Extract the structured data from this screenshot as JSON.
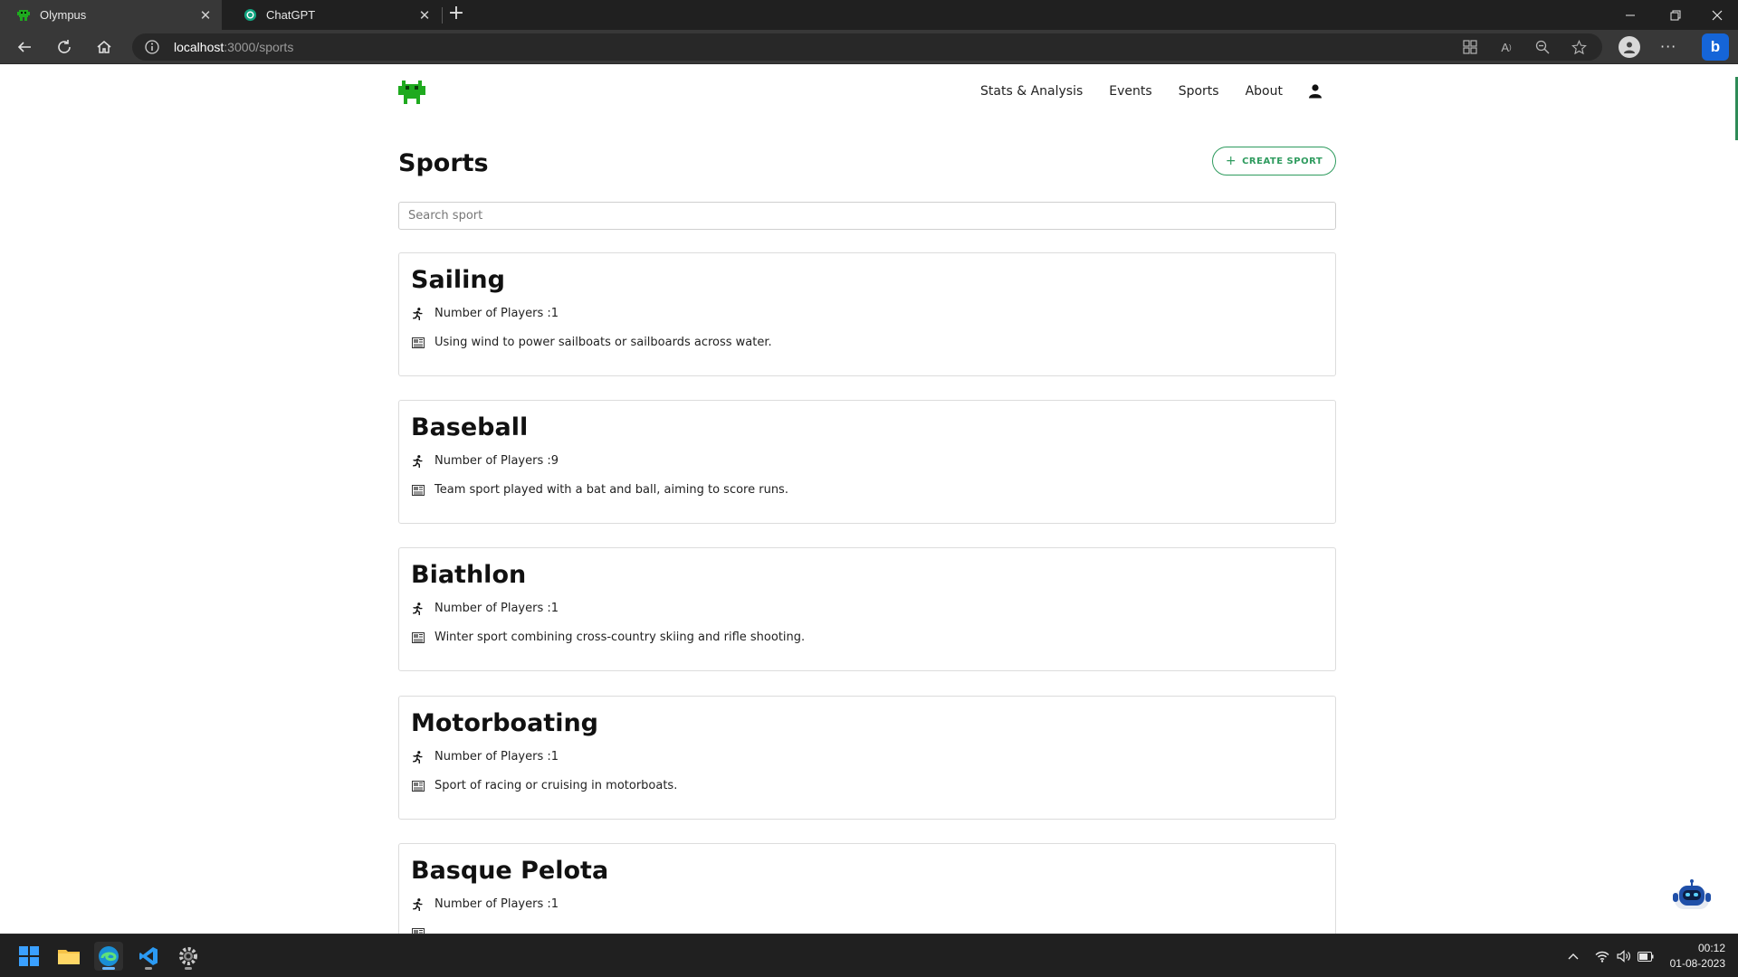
{
  "browser": {
    "tabs": [
      {
        "title": "Olympus",
        "active": true
      },
      {
        "title": "ChatGPT",
        "active": false
      }
    ],
    "url_host": "localhost",
    "url_path": ":3000/sports"
  },
  "site": {
    "nav": {
      "stats": "Stats & Analysis",
      "events": "Events",
      "sports": "Sports",
      "about": "About"
    },
    "page_title": "Sports",
    "create_button": "CREATE SPORT",
    "search_placeholder": "Search sport",
    "players_label": "Number of Players : ",
    "sports": [
      {
        "name": "Sailing",
        "players": "1",
        "description": "Using wind to power sailboats or sailboards across water."
      },
      {
        "name": "Baseball",
        "players": "9",
        "description": "Team sport played with a bat and ball, aiming to score runs."
      },
      {
        "name": "Biathlon",
        "players": "1",
        "description": "Winter sport combining cross-country skiing and rifle shooting."
      },
      {
        "name": "Motorboating",
        "players": "1",
        "description": "Sport of racing or cruising in motorboats."
      },
      {
        "name": "Basque Pelota",
        "players": "1",
        "description": ""
      }
    ]
  },
  "taskbar": {
    "time": "00:12",
    "date": "01-08-2023"
  },
  "colors": {
    "accent": "#2e9b5e",
    "logo": "#1faa1f",
    "browser_dark": "#202020"
  }
}
